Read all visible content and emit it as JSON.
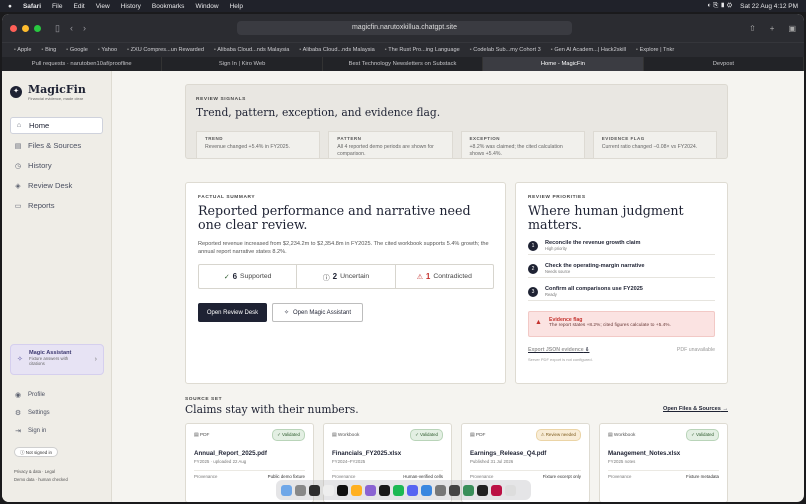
{
  "menubar": {
    "apple": "",
    "app": "Safari",
    "items": [
      "File",
      "Edit",
      "View",
      "History",
      "Bookmarks",
      "Window",
      "Help"
    ],
    "right": "Sat 22 Aug 4:12 PM"
  },
  "browser": {
    "url": "magicfin.narutoxkillua.chatgpt.site",
    "favorites": [
      "Apple",
      "Bing",
      "Google",
      "Yahoo",
      "ZXU Compres...un Rewarded",
      "Alibaba Cloud...nds Malaysia",
      "Alibaba Cloud...nds Malaysia",
      "The Rust Pro...ing Language",
      "Codelab Sub...my Cohort 3",
      "Gen AI Academ...| Hack2skill",
      "Explore | Tnkr"
    ],
    "tabs": [
      "Pull requests · narutoben10af/proofline",
      "Sign In | Kiro Web",
      "Best Technology Newsletters on Substack",
      "Home - MagicFin",
      "Devpost"
    ]
  },
  "sidebar": {
    "logo_mark": "✦",
    "title": "MagicFin",
    "subtitle": "Financial evidence, made clear",
    "nav": [
      {
        "icon": "⌂",
        "label": "Home"
      },
      {
        "icon": "▤",
        "label": "Files & Sources"
      },
      {
        "icon": "◷",
        "label": "History"
      },
      {
        "icon": "◈",
        "label": "Review Desk"
      },
      {
        "icon": "▭",
        "label": "Reports"
      }
    ],
    "assistant": {
      "title": "Magic Assistant",
      "subtitle": "Fixture answers with citations",
      "chevron": "›"
    },
    "bottom": [
      {
        "icon": "◉",
        "label": "Profile"
      },
      {
        "icon": "⚙",
        "label": "Settings"
      },
      {
        "icon": "⇥",
        "label": "Sign in"
      }
    ],
    "signed_in": "Not signed in",
    "footer_links": "Privacy & data  ·  Legal",
    "footer_note": "Demo data · human checked"
  },
  "signals": {
    "kicker": "REVIEW SIGNALS",
    "title": "Trend, pattern, exception, and evidence flag.",
    "cards": [
      {
        "k": "TREND",
        "v": "Revenue changed +5.4% in FY2025."
      },
      {
        "k": "PATTERN",
        "v": "All 4 reported demo periods are shown for comparison."
      },
      {
        "k": "EXCEPTION",
        "v": "+8.2% was claimed; the cited calculation shows +5.4%."
      },
      {
        "k": "EVIDENCE FLAG",
        "v": "Current ratio changed −0.08× vs FY2024."
      }
    ]
  },
  "factual": {
    "kicker": "FACTUAL SUMMARY",
    "title": "Reported performance and narrative need one clear review.",
    "body": "Reported revenue increased from $2,234.2m to $2,354.8m in FY2025. The cited workbook supports 5.4% growth; the annual report narrative states 8.2%.",
    "stats": [
      {
        "n": "6",
        "label": "Supported",
        "icon": "✓"
      },
      {
        "n": "2",
        "label": "Uncertain",
        "icon": "ⓘ"
      },
      {
        "n": "1",
        "label": "Contradicted",
        "icon": "⚠"
      }
    ],
    "btn_primary": "Open Review Desk",
    "btn_secondary": "Open Magic Assistant"
  },
  "priorities": {
    "kicker": "REVIEW PRIORITIES",
    "title": "Where human judgment matters.",
    "items": [
      {
        "n": "1",
        "t": "Reconcile the revenue growth claim",
        "s": "High priority"
      },
      {
        "n": "2",
        "t": "Check the operating-margin narrative",
        "s": "Needs source"
      },
      {
        "n": "3",
        "t": "Confirm all comparisons use FY2025",
        "s": "Ready"
      }
    ],
    "flag_title": "Evidence flag",
    "flag_text": "The report states +8.2%; cited figures calculate to +5.4%.",
    "export": "Export JSON evidence",
    "pdf": "PDF unavailable",
    "note": "Server PDF export is not configured."
  },
  "sources": {
    "kicker": "SOURCE SET",
    "title": "Claims stay with their numbers.",
    "open": "Open Files & Sources",
    "cards": [
      {
        "type": "PDF",
        "badge": "Validated",
        "badge_kind": "valid",
        "name": "Annual_Report_2025.pdf",
        "meta": "FY2025 · uploaded 22 Aug",
        "prov": "Public demo fixture"
      },
      {
        "type": "Workbook",
        "badge": "Validated",
        "badge_kind": "valid",
        "name": "Financials_FY2025.xlsx",
        "meta": "FY2024–FY2025",
        "prov": "Human-verified cells"
      },
      {
        "type": "PDF",
        "badge": "Review needed",
        "badge_kind": "review",
        "name": "Earnings_Release_Q4.pdf",
        "meta": "Published 31 Jul 2026",
        "prov": "Fixture excerpt only"
      },
      {
        "type": "Workbook",
        "badge": "Validated",
        "badge_kind": "valid",
        "name": "Management_Notes.xlsx",
        "meta": "FY2025 notes",
        "prov": "Fixture metadata"
      }
    ],
    "prov_label": "Provenance"
  },
  "dock_colors": [
    "#6fa7e8",
    "#888",
    "#2d2d2d",
    "#eee",
    "#111",
    "#ffb020",
    "#8a63d2",
    "#1a1a1a",
    "#1db954",
    "#5865f2",
    "#3a87e0",
    "#777",
    "#444",
    "#3a8f5a",
    "#222",
    "#b14",
    "#ddd"
  ]
}
